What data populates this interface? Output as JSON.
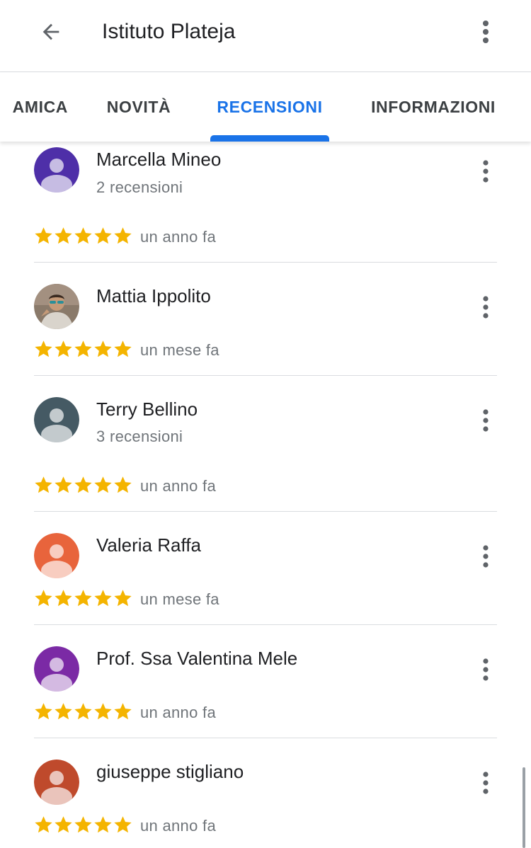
{
  "header": {
    "title": "Istituto Plateja",
    "back_icon": "arrow-back-icon",
    "more_icon": "more-vert-icon"
  },
  "tabs": [
    {
      "label": "AMICA",
      "active": false
    },
    {
      "label": "NOVITÀ",
      "active": false
    },
    {
      "label": "RECENSIONI",
      "active": true
    },
    {
      "label": "INFORMAZIONI",
      "active": false
    }
  ],
  "colors": {
    "accent": "#1a73e8",
    "star": "#f4b400",
    "secondary_text": "#70757a",
    "divider": "#dadce0"
  },
  "reviews": [
    {
      "name": "Marcella Mineo",
      "count": "2 recensioni",
      "rating": 5,
      "time": "un anno fa",
      "avatar_color": "#4e2fa8",
      "avatar_type": "placeholder"
    },
    {
      "name": "Mattia Ippolito",
      "count": "",
      "rating": 5,
      "time": "un mese fa",
      "avatar_color": "#8a7a6a",
      "avatar_type": "photo"
    },
    {
      "name": "Terry Bellino",
      "count": "3 recensioni",
      "rating": 5,
      "time": "un anno fa",
      "avatar_color": "#455a64",
      "avatar_type": "placeholder"
    },
    {
      "name": "Valeria Raffa",
      "count": "",
      "rating": 5,
      "time": "un mese fa",
      "avatar_color": "#e8643c",
      "avatar_type": "placeholder"
    },
    {
      "name": "Prof. Ssa Valentina Mele",
      "count": "",
      "rating": 5,
      "time": "un anno fa",
      "avatar_color": "#7b2aa5",
      "avatar_type": "placeholder"
    },
    {
      "name": "giuseppe stigliano",
      "count": "",
      "rating": 5,
      "time": "un anno fa",
      "avatar_color": "#bf4a2c",
      "avatar_type": "placeholder"
    }
  ]
}
